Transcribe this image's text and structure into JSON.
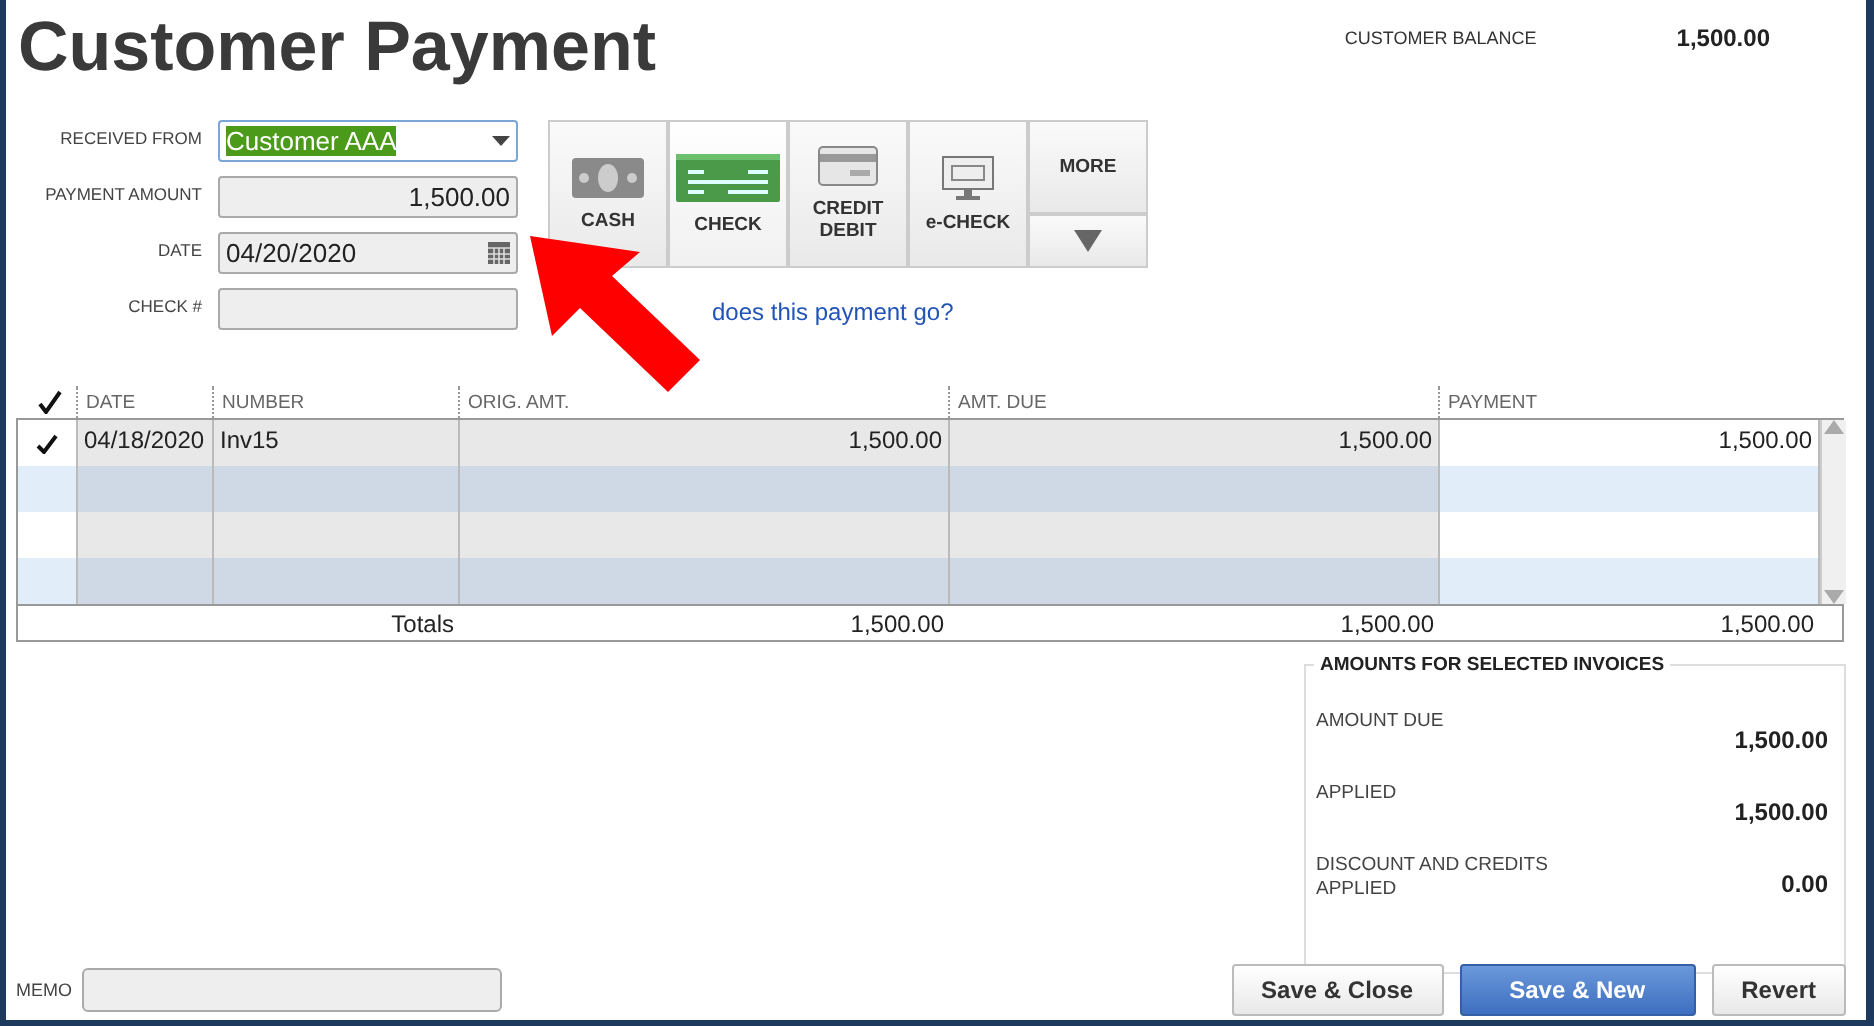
{
  "window": {
    "title": "Customer Payment"
  },
  "customer_balance": {
    "label": "CUSTOMER BALANCE",
    "value": "1,500.00"
  },
  "fields": [
    {
      "label": "RECEIVED FROM",
      "value": "Customer AAA",
      "kind": "dropdown",
      "text_selected": true
    },
    {
      "label": "PAYMENT AMOUNT",
      "value": "1,500.00",
      "kind": "amount"
    },
    {
      "label": "DATE",
      "value": "04/20/2020",
      "kind": "date"
    },
    {
      "label": "CHECK #",
      "kind": "text"
    }
  ],
  "payment_methods": [
    {
      "label": "CASH",
      "kind": "cash",
      "selected": false
    },
    {
      "label": "CHECK",
      "kind": "check",
      "selected": true
    },
    {
      "label": "CREDIT DEBIT",
      "kind": "card",
      "selected": false
    },
    {
      "label": "e-CHECK",
      "kind": "echeck",
      "selected": false
    }
  ],
  "more_button": {
    "label": "MORE"
  },
  "link": "does this payment go?",
  "table": {
    "columns": [
      "DATE",
      "NUMBER",
      "ORIG. AMT.",
      "AMT. DUE",
      "PAYMENT"
    ],
    "rows": [
      {
        "checked": true,
        "cells": [
          "04/18/2020",
          "Inv15",
          "1,500.00",
          "1,500.00",
          "1,500.00"
        ]
      }
    ],
    "totals": {
      "label": "Totals",
      "values": [
        "1,500.00",
        "1,500.00",
        "1,500.00"
      ]
    }
  },
  "amounts": {
    "title": "AMOUNTS FOR SELECTED INVOICES",
    "items": [
      {
        "label": "AMOUNT DUE",
        "value": "1,500.00"
      },
      {
        "label": "APPLIED",
        "value": "1,500.00"
      },
      {
        "label": "DISCOUNT AND CREDITS APPLIED",
        "value": "0.00"
      }
    ]
  },
  "memo": {
    "label": "MEMO"
  },
  "buttons": [
    {
      "label": "Save & Close",
      "primary": false
    },
    {
      "label": "Save & New",
      "primary": true
    },
    {
      "label": "Revert",
      "primary": false
    }
  ]
}
